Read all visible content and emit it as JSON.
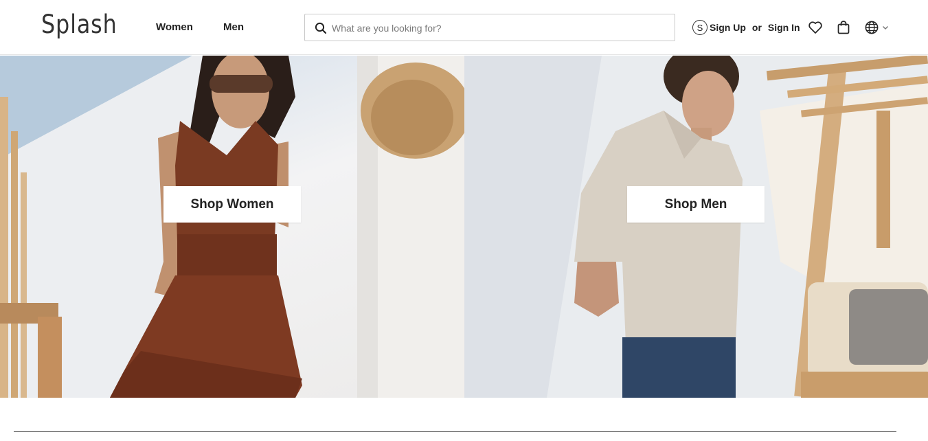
{
  "brand": {
    "logo_text": "Splash"
  },
  "nav": {
    "women_label": "Women",
    "men_label": "Men"
  },
  "search": {
    "placeholder": "What are you looking for?",
    "value": ""
  },
  "account": {
    "icon_letter": "S",
    "sign_up_label": "Sign Up",
    "or_label": "or",
    "sign_in_label": "Sign In"
  },
  "icons": [
    "search-icon",
    "user-s-icon",
    "heart-icon",
    "shopping-bag-icon",
    "globe-icon",
    "chevron-down-icon"
  ],
  "hero": {
    "women": {
      "button_label": "Shop Women"
    },
    "men": {
      "button_label": "Shop Men"
    }
  },
  "colors": {
    "text": "#1d1d1f",
    "button_bg": "#ffffff",
    "border": "#c9c9c9"
  }
}
